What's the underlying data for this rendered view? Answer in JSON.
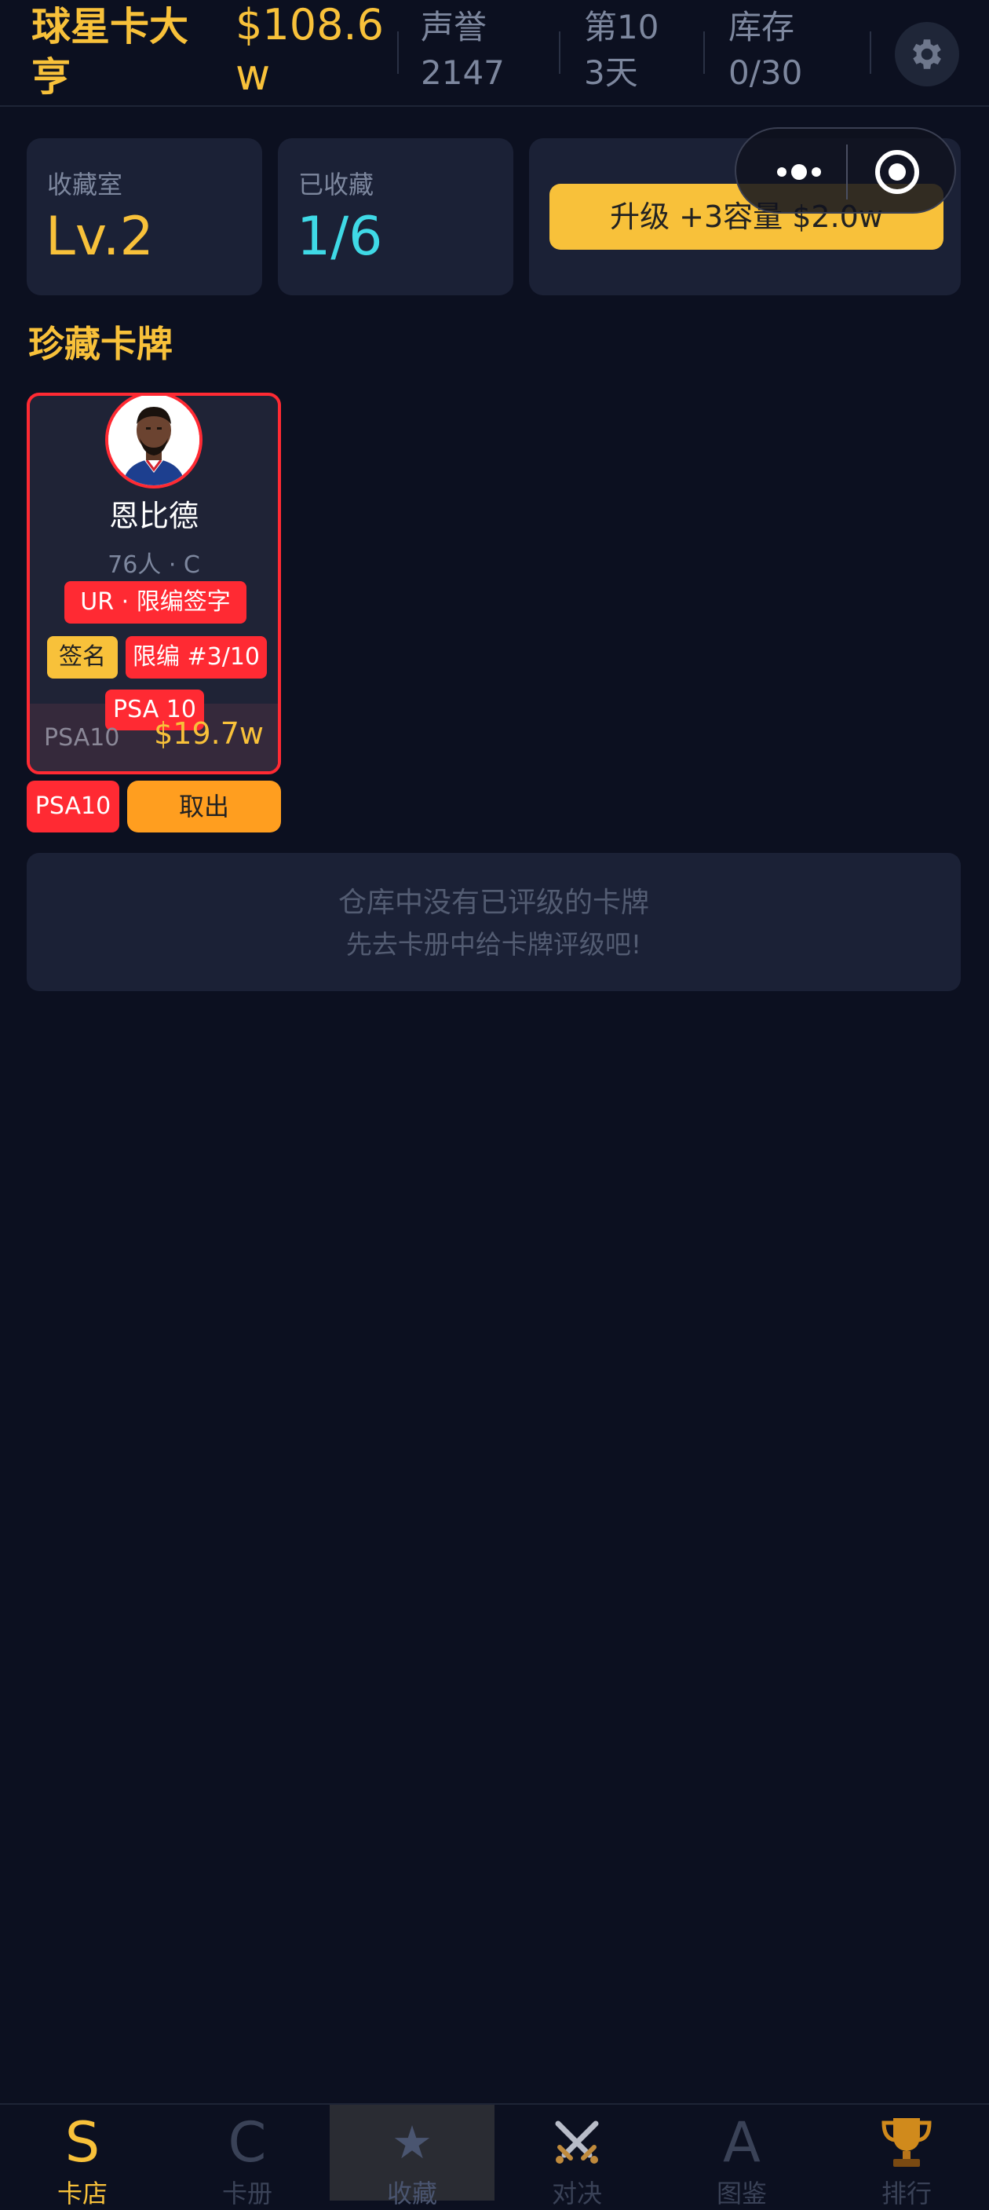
{
  "header": {
    "title": "球星卡大亨",
    "money": "$108.6w",
    "reputation_label": "声誉",
    "reputation_value": "2147",
    "day": "第103天",
    "inventory_label": "库存",
    "inventory_value": "0/30",
    "settings_icon": "gear-icon"
  },
  "capsule": {
    "more_icon": "more-dots-icon",
    "close_icon": "record-circle-icon"
  },
  "stats": {
    "room_label": "收藏室",
    "room_value": "Lv.2",
    "collected_label": "已收藏",
    "collected_value": "1/6",
    "upgrade_label": "升级 +3容量  $2.0w"
  },
  "section_title": "珍藏卡牌",
  "card": {
    "player_name": "恩比德",
    "team_position": "76人 · C",
    "rarity_tag": "UR · 限编签字",
    "signed_tag": "签名",
    "limited_tag": "限编 #3/10",
    "psa_overlay": "PSA 10",
    "grade_label": "PSA10",
    "price": "$19.7w",
    "avatar_icon": "player-avatar"
  },
  "card_actions": {
    "psa_button": "PSA10",
    "take_out_button": "取出"
  },
  "empty_state": {
    "line1": "仓库中没有已评级的卡牌",
    "line2": "先去卡册中给卡牌评级吧!"
  },
  "nav": [
    {
      "icon": "S",
      "label": "卡店",
      "active": true
    },
    {
      "icon": "C",
      "label": "卡册",
      "active": false
    },
    {
      "icon": "★",
      "label": "收藏",
      "active": false
    },
    {
      "icon": "swords-icon",
      "label": "对决",
      "active": false
    },
    {
      "icon": "A",
      "label": "图鉴",
      "active": false
    },
    {
      "icon": "trophy-icon",
      "label": "排行",
      "active": false
    }
  ],
  "colors": {
    "background": "#0c1020",
    "accent_gold": "#f8c13a",
    "accent_red": "#ff2a33",
    "accent_orange": "#ff9e1f",
    "accent_cyan": "#3fd9e6",
    "panel": "#1b2136"
  }
}
